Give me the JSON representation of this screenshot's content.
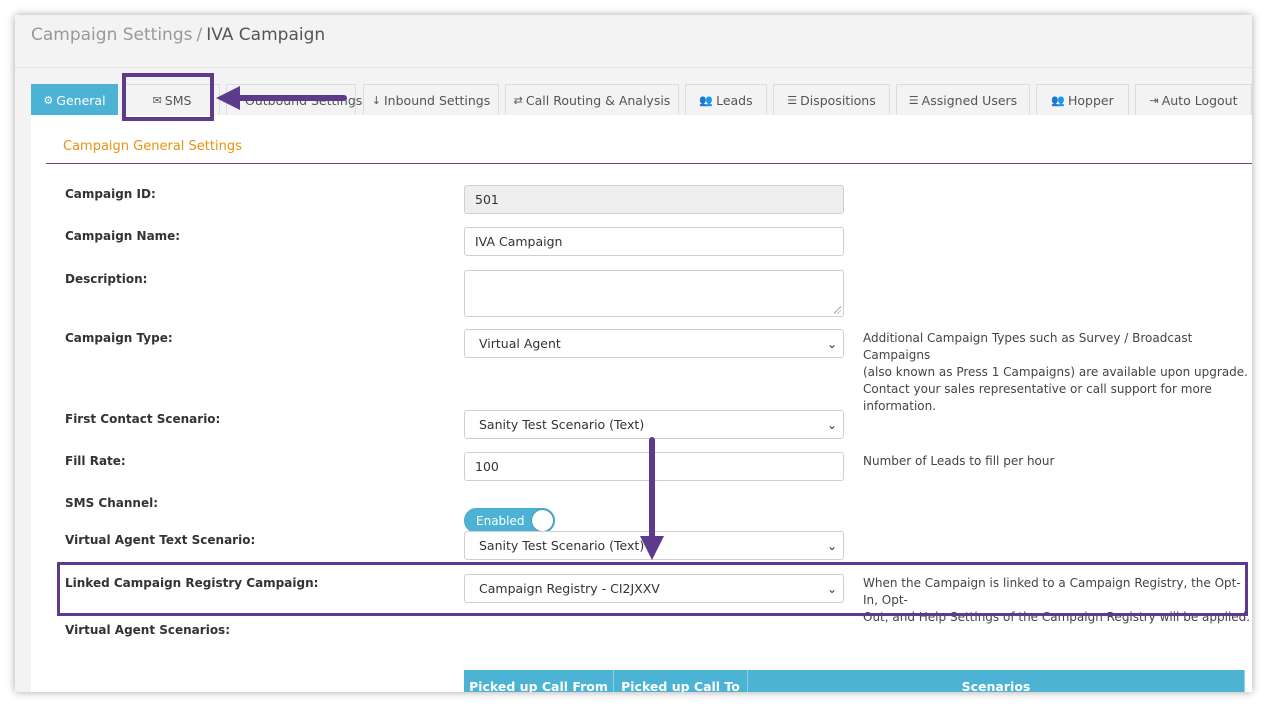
{
  "breadcrumb": {
    "parent": "Campaign Settings",
    "separator": "/",
    "current": "IVA Campaign"
  },
  "tabs": [
    {
      "label": "General",
      "icon": "gears-icon",
      "glyph": "⚙",
      "active": true
    },
    {
      "label": "SMS",
      "icon": "envelope-icon",
      "glyph": "✉",
      "active": false
    },
    {
      "label": "Outbound Settings",
      "icon": "",
      "glyph": "",
      "active": false
    },
    {
      "label": "Inbound Settings",
      "icon": "arrow-down-icon",
      "glyph": "↓",
      "active": false
    },
    {
      "label": "Call Routing & Analysis",
      "icon": "shuffle-icon",
      "glyph": "⇄",
      "active": false
    },
    {
      "label": "Leads",
      "icon": "users-icon",
      "glyph": "👥",
      "active": false
    },
    {
      "label": "Dispositions",
      "icon": "list-icon",
      "glyph": "☰",
      "active": false
    },
    {
      "label": "Assigned Users",
      "icon": "ordered-list-icon",
      "glyph": "☰",
      "active": false
    },
    {
      "label": "Hopper",
      "icon": "users-icon",
      "glyph": "👥",
      "active": false
    },
    {
      "label": "Auto Logout",
      "icon": "sign-out-icon",
      "glyph": "⇥",
      "active": false
    }
  ],
  "section_title": "Campaign General Settings",
  "form": {
    "campaign_id": {
      "label": "Campaign ID:",
      "value": "501"
    },
    "campaign_name": {
      "label": "Campaign Name:",
      "value": "IVA Campaign"
    },
    "description": {
      "label": "Description:",
      "value": ""
    },
    "campaign_type": {
      "label": "Campaign Type:",
      "value": "Virtual Agent",
      "help": [
        "Additional Campaign Types such as Survey / Broadcast Campaigns",
        "(also known as Press 1 Campaigns) are available upon upgrade.",
        "Contact your sales representative or call support for more",
        "information."
      ]
    },
    "first_contact": {
      "label": "First Contact Scenario:",
      "value": "Sanity Test Scenario (Text)"
    },
    "fill_rate": {
      "label": "Fill Rate:",
      "value": "100",
      "help": "Number of Leads to fill per hour"
    },
    "sms_channel": {
      "label": "SMS Channel:",
      "value": "Enabled"
    },
    "va_text_scenario": {
      "label": "Virtual Agent Text Scenario:",
      "value": "Sanity Test Scenario (Text)"
    },
    "linked_registry": {
      "label": "Linked Campaign Registry Campaign:",
      "value": "Campaign Registry - CI2JXXV",
      "help": [
        "When the Campaign is linked to a Campaign Registry, the Opt-In, Opt-",
        "Out, and Help Settings of the Campaign Registry will be applied."
      ]
    },
    "va_scenarios": {
      "label": "Virtual Agent Scenarios:"
    }
  },
  "table": {
    "headers": [
      "Picked up Call From",
      "Picked up Call To",
      "Scenarios"
    ]
  },
  "colors": {
    "accent": "#4cb3d4",
    "annotation": "#5e3a8c",
    "section_title": "#e8920f"
  }
}
